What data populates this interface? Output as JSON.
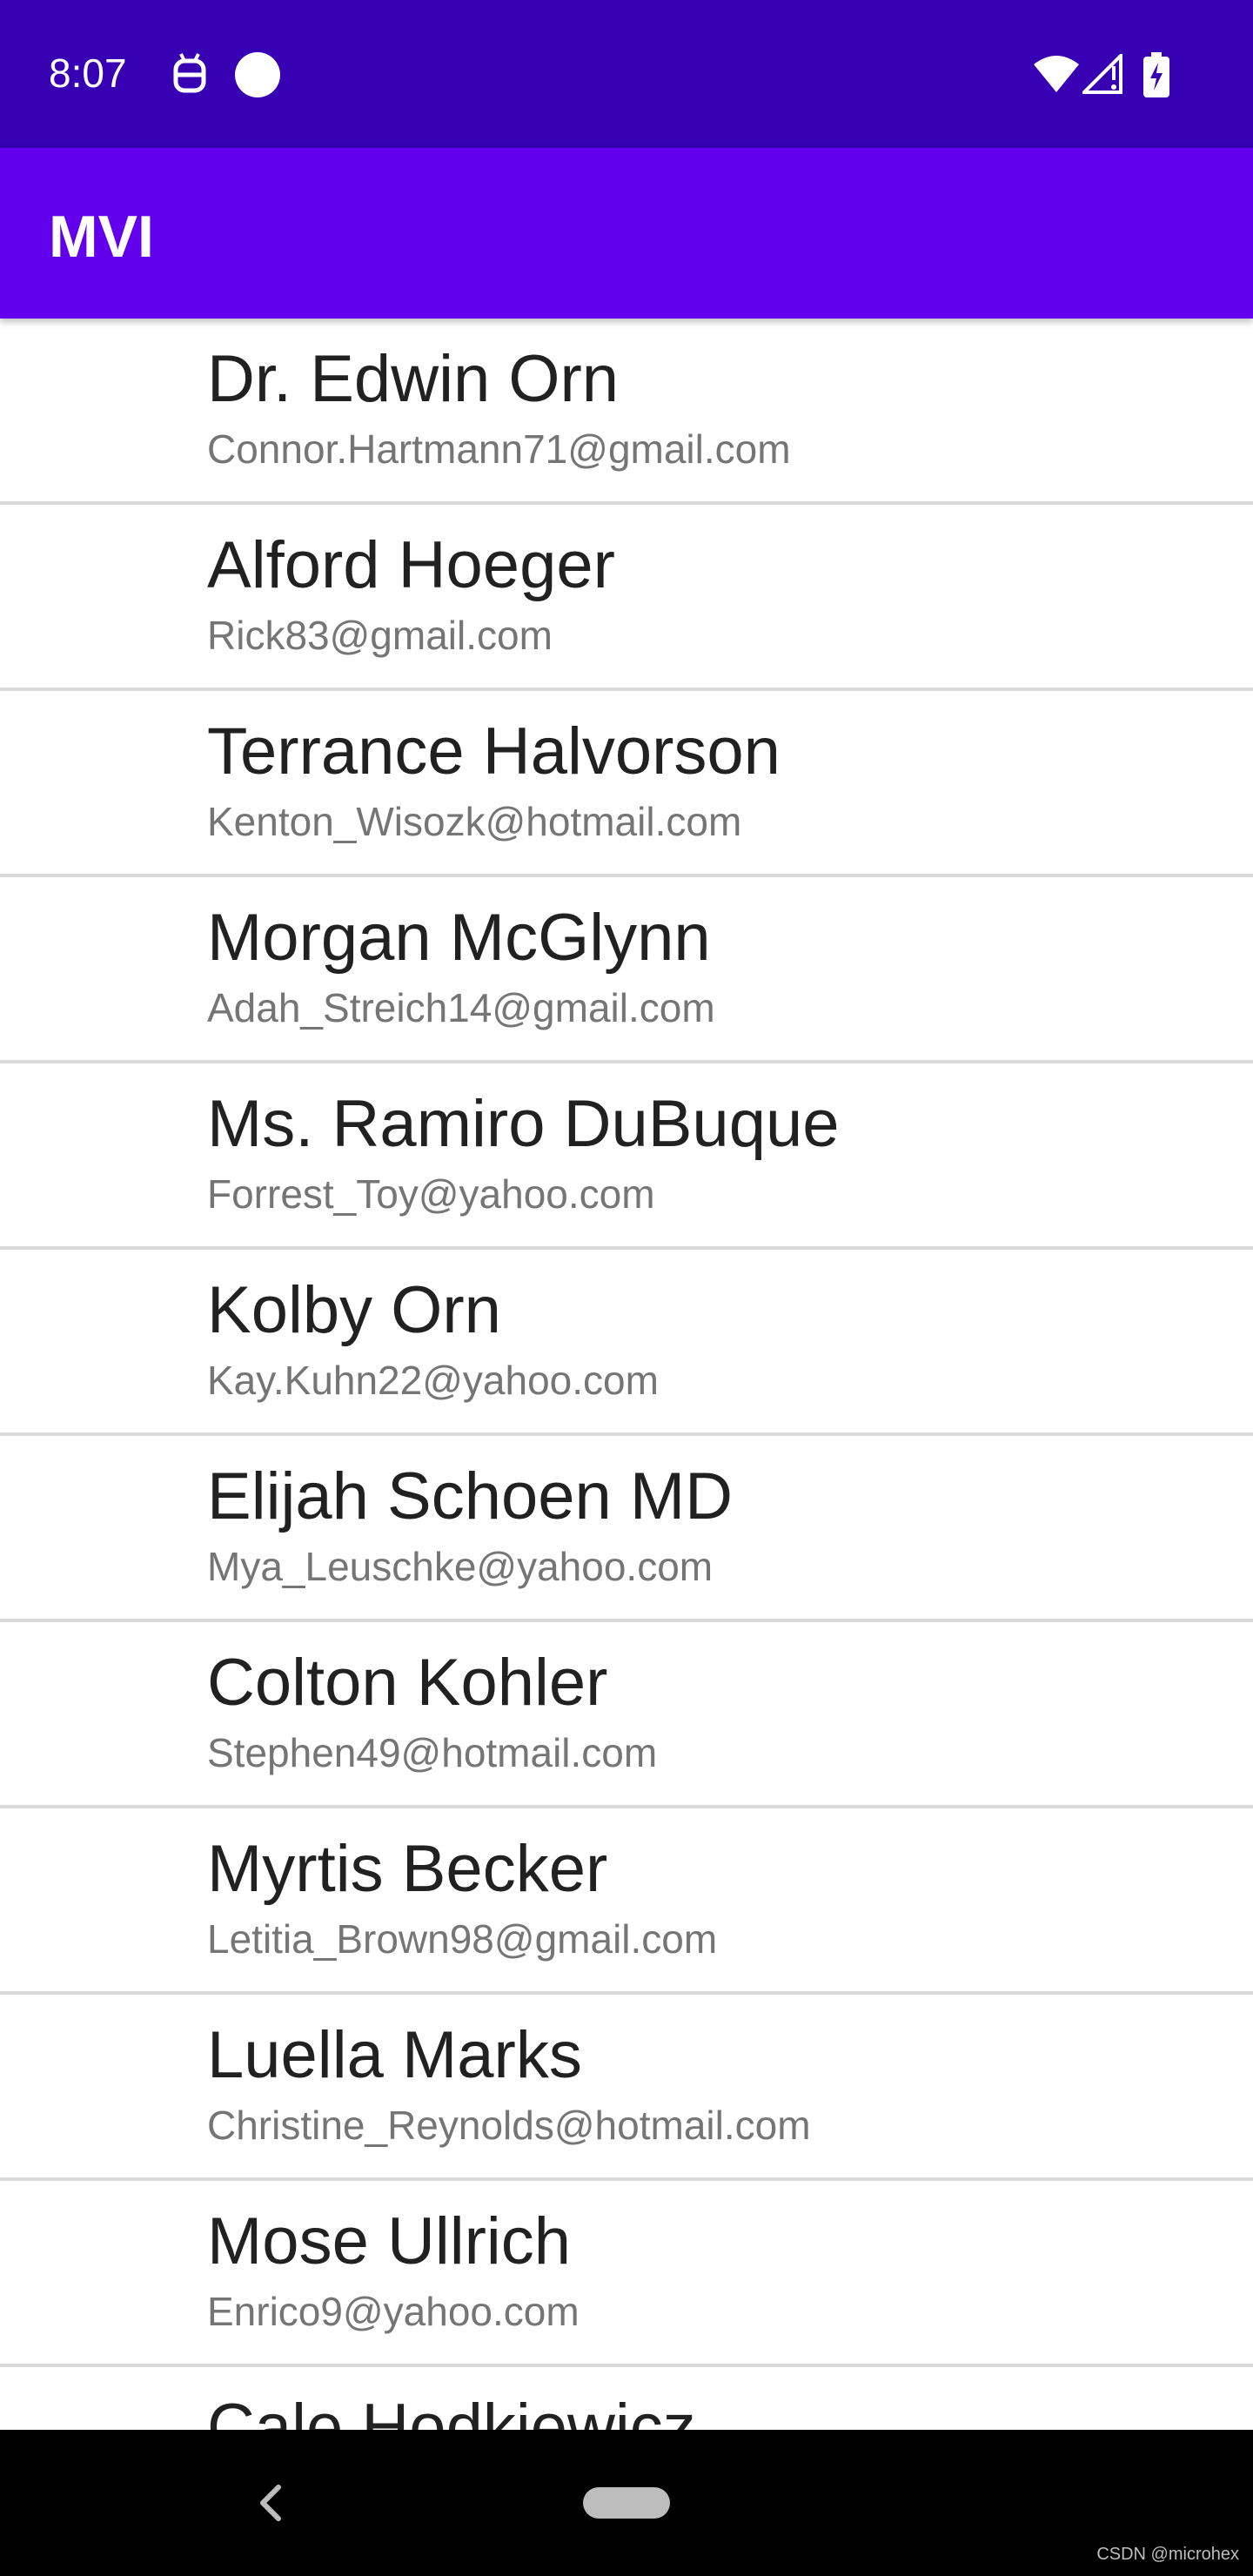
{
  "status_bar": {
    "time": "8:07",
    "left_icons": [
      "android-debug-icon",
      "circle-dot-icon"
    ],
    "right_icons": [
      "wifi-icon",
      "cell-signal-icon",
      "battery-charging-icon"
    ]
  },
  "app_bar": {
    "title": "MVI"
  },
  "contacts": [
    {
      "name": "Dr. Edwin Orn",
      "email": "Connor.Hartmann71@gmail.com"
    },
    {
      "name": "Alford Hoeger",
      "email": "Rick83@gmail.com"
    },
    {
      "name": "Terrance Halvorson",
      "email": "Kenton_Wisozk@hotmail.com"
    },
    {
      "name": "Morgan McGlynn",
      "email": "Adah_Streich14@gmail.com"
    },
    {
      "name": "Ms. Ramiro DuBuque",
      "email": "Forrest_Toy@yahoo.com"
    },
    {
      "name": "Kolby Orn",
      "email": "Kay.Kuhn22@yahoo.com"
    },
    {
      "name": "Elijah Schoen MD",
      "email": "Mya_Leuschke@yahoo.com"
    },
    {
      "name": "Colton Kohler",
      "email": "Stephen49@hotmail.com"
    },
    {
      "name": "Myrtis Becker",
      "email": "Letitia_Brown98@gmail.com"
    },
    {
      "name": "Luella Marks",
      "email": "Christine_Reynolds@hotmail.com"
    },
    {
      "name": "Mose Ullrich",
      "email": "Enrico9@yahoo.com"
    },
    {
      "name": "Cale Hodkiewicz",
      "email": ""
    }
  ],
  "nav_bar": {
    "icons": [
      "back-icon",
      "home-pill-icon"
    ]
  },
  "watermark": "CSDN @microhex",
  "colors": {
    "status_bar": "#3700b3",
    "app_bar": "#6200ee",
    "name_text": "#212121",
    "email_text": "#757575",
    "divider": "#d9d9d9"
  }
}
